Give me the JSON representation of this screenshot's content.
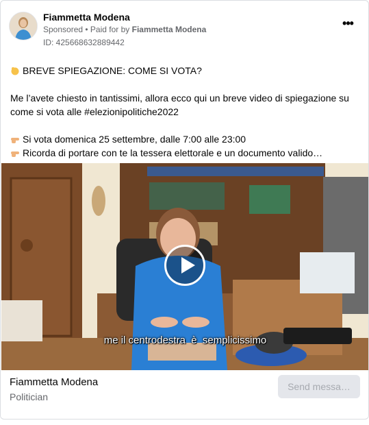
{
  "header": {
    "page_name": "Fiammetta Modena",
    "sponsored": "Sponsored",
    "paid_for_prefix": " • Paid for by ",
    "paid_for_name": "Fiammetta Modena",
    "ad_id": "ID: 425668632889442",
    "more_icon": "ellipsis-icon"
  },
  "body": {
    "line1": "BREVE SPIEGAZIONE: COME SI VOTA?",
    "line2": "Me l’avete chiesto in tantissimi, allora ecco qui un breve video di spiegazione su come si vota alle #elezionipolitiche2022",
    "line3": "Si vota domenica 25 settembre, dalle 7:00 alle 23:00",
    "line4": "Ricorda di portare con te la tessera elettorale e un documento valido…"
  },
  "video": {
    "subtitle": "me il centrodestra  è  semplicissimo",
    "play_icon": "play-icon"
  },
  "footer": {
    "name": "Fiammetta Modena",
    "category": "Politician",
    "button": "Send messa…"
  },
  "colors": {
    "secondary_text": "#65676b",
    "button_bg": "#e4e6eb",
    "button_text": "#a7aab0"
  }
}
